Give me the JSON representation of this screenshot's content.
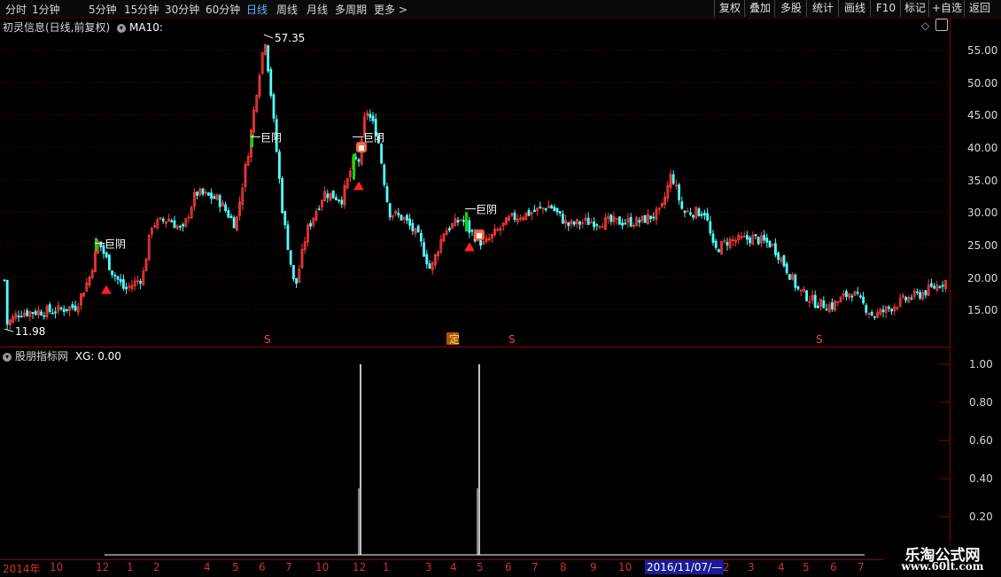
{
  "toolbar": {
    "periods": [
      "分时",
      "1分钟",
      "5分钟",
      "15分钟",
      "30分钟",
      "60分钟",
      "日线",
      "周线",
      "月线",
      "多周期",
      "更多"
    ],
    "active_period": "日线",
    "more_arrow": ">",
    "right_buttons": [
      "复权",
      "叠加",
      "多股",
      "统计",
      "画线",
      "F10",
      "标记",
      "+自选",
      "返回"
    ]
  },
  "main": {
    "title": "初灵信息(日线,前复权)",
    "indicator": "MA10:",
    "price_labels": [
      "55.00",
      "50.00",
      "45.00",
      "40.00",
      "35.00",
      "30.00",
      "25.00",
      "20.00",
      "15.00"
    ],
    "high_mark": "57.35",
    "low_mark": "11.98",
    "signal_text": "巨阴",
    "event_markers": [
      "S",
      "定",
      "S",
      "S"
    ]
  },
  "indicator_panel": {
    "title": "股朋指标网",
    "value_label": "XG: 0.00",
    "y_labels": [
      "1.00",
      "0.80",
      "0.60",
      "0.40",
      "0.20"
    ],
    "spikes": [
      1,
      1
    ]
  },
  "date_axis": {
    "year": "2014年",
    "months": [
      "10",
      "12",
      "1",
      "2",
      "4",
      "5",
      "6",
      "7",
      "10",
      "12",
      "1",
      "3",
      "4",
      "5",
      "6",
      "7",
      "8",
      "9",
      "10",
      "2",
      "3",
      "4",
      "5",
      "6",
      "7"
    ],
    "selected": "2016/11/07/—"
  },
  "watermark": {
    "line1": "乐淘公式网",
    "line2": "www.60lt.com"
  },
  "colors": {
    "up": "#ff3b3b",
    "down": "#54ffff",
    "signal_green": "#00e000",
    "axis": "#8a0000",
    "active_tab": "#5fb6ff"
  }
}
